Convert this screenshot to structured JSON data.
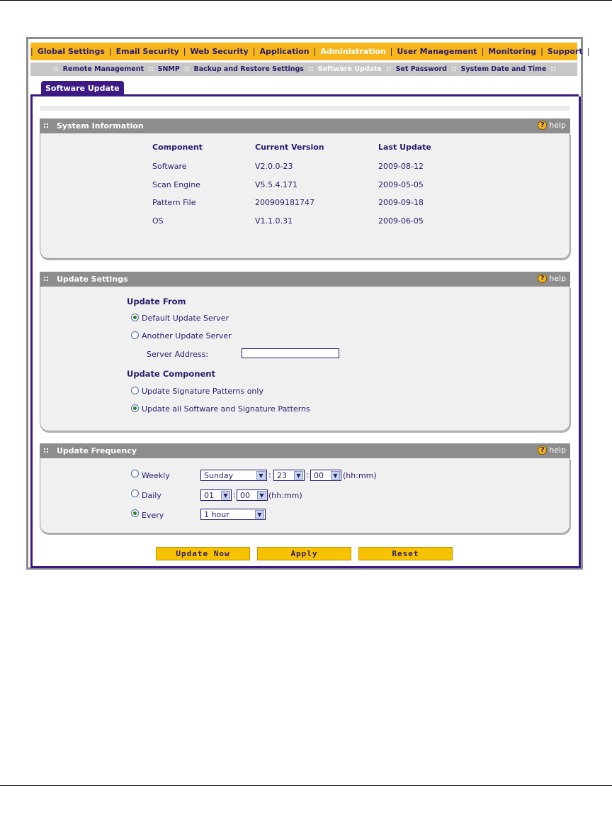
{
  "nav": {
    "items": [
      "Global Settings",
      "Email Security",
      "Web Security",
      "Application",
      "Administration",
      "User Management",
      "Monitoring",
      "Support"
    ],
    "active": "Administration"
  },
  "subnav": {
    "items": [
      "Remote Management",
      "SNMP",
      "Backup and Restore Settings",
      "Software Update",
      "Set Password",
      "System Date and Time"
    ],
    "active": "Software Update"
  },
  "tab": {
    "label": "Software Update"
  },
  "help_label": "help",
  "system_info": {
    "title": "System Information",
    "headers": {
      "component": "Component",
      "version": "Current Version",
      "updated": "Last Update"
    },
    "rows": [
      {
        "component": "Software",
        "version": "V2.0.0-23",
        "updated": "2009-08-12"
      },
      {
        "component": "Scan Engine",
        "version": "V5.5.4.171",
        "updated": "2009-05-05"
      },
      {
        "component": "Pattern File",
        "version": "200909181747",
        "updated": "2009-09-18"
      },
      {
        "component": "OS",
        "version": "V1.1.0.31",
        "updated": "2009-06-05"
      }
    ]
  },
  "update_settings": {
    "title": "Update Settings",
    "from_label": "Update From",
    "default_server": "Default Update Server",
    "another_server": "Another Update Server",
    "server_address_label": "Server Address:",
    "server_address_value": "",
    "component_label": "Update Component",
    "sig_only": "Update Signature Patterns only",
    "all_software": "Update all Software and Signature Patterns"
  },
  "update_frequency": {
    "title": "Update Frequency",
    "weekly_label": "Weekly",
    "weekly_day": "Sunday",
    "weekly_hour": "23",
    "weekly_min": "00",
    "daily_label": "Daily",
    "daily_hour": "01",
    "daily_min": "00",
    "every_label": "Every",
    "every_value": "1 hour",
    "hhmm": "(hh:mm)",
    "colon": ":"
  },
  "buttons": {
    "update_now": "Update Now",
    "apply": "Apply",
    "reset": "Reset"
  },
  "colors": {
    "accent": "#f7b71c",
    "primary": "#3b1a83",
    "header_grey": "#8d8d8d"
  }
}
